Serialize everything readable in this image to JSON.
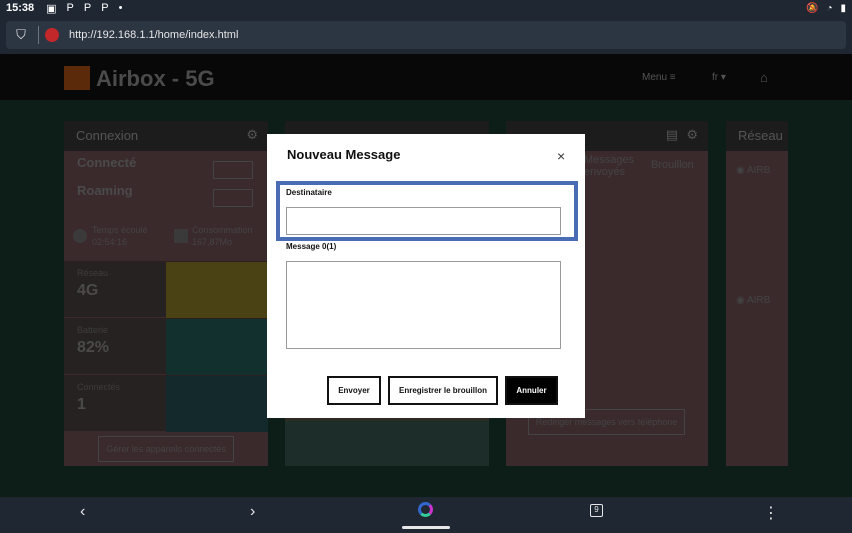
{
  "status_bar": {
    "time": "15:38",
    "icons": [
      "image-icon",
      "p-icon",
      "p-icon",
      "p-icon",
      "dot-icon"
    ],
    "right_icons": [
      "mute-icon",
      "wifi-icon",
      "battery-icon"
    ]
  },
  "browser": {
    "url": "http://192.168.1.1/home/index.html"
  },
  "site": {
    "brand": "Airbox - 5G",
    "menu_label": "Menu",
    "lang_label": "fr",
    "connexion_card": {
      "title": "Connexion",
      "status": "Connecté",
      "roaming": "Roaming",
      "time_label": "Temps écoulé",
      "time_value": "02:54:16",
      "consumption_label": "Consommation",
      "consumption_value": "167,87Mo",
      "network_label": "Réseau",
      "network_value": "4G",
      "battery_label": "Batterie",
      "battery_value": "82%",
      "connected_label": "Connectés",
      "connected_value": "1",
      "view_devices": "Gérer les appareils connectés"
    },
    "messages_card": {
      "tab_sent": "Messages envoyés",
      "tab_draft": "Brouillon",
      "redirect": "Rediriger messages vers téléphone"
    },
    "network_card": {
      "title": "Réseau",
      "item1": "AIRB",
      "item2": "AIRB"
    }
  },
  "modal": {
    "title": "Nouveau Message",
    "close_symbol": "×",
    "recipient_label": "Destinataire",
    "recipient_value": "",
    "message_label": "Message 0(1)",
    "message_value": "",
    "send_label": "Envoyer",
    "save_draft_label": "Enregistrer le brouillon",
    "cancel_label": "Annuler"
  },
  "bottom_nav": {
    "tab_count": "9"
  }
}
